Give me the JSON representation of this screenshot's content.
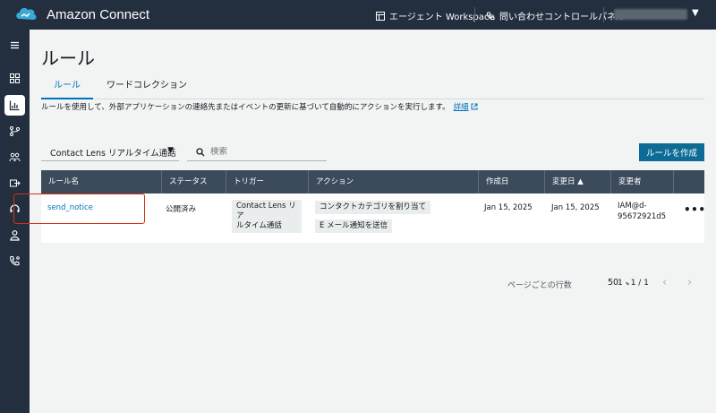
{
  "header": {
    "brand": "Amazon Connect",
    "agent_workspace": "エージェント Workspace",
    "ccp": "問い合わせコントロールパネル"
  },
  "nav": {
    "icons": [
      "menu-icon",
      "dashboard-icon",
      "analytics-icon",
      "routing-icon",
      "users-icon",
      "channels-icon",
      "headset-icon",
      "profile-icon",
      "phone-icon"
    ]
  },
  "page": {
    "title": "ルール",
    "tabs": [
      "ルール",
      "ワードコレクション"
    ],
    "description": "ルールを使用して、外部アプリケーションの連絡先またはイベントの更新に基づいて自動的にアクションを実行します。",
    "details_link": "詳細"
  },
  "filters": {
    "type_select": "Contact Lens リアルタイム通話",
    "search_placeholder": "検索",
    "create_button": "ルールを作成"
  },
  "table": {
    "headers": [
      "ルール名",
      "ステータス",
      "トリガー",
      "アクション",
      "作成日",
      "変更日 ▲",
      "変更者"
    ],
    "row": {
      "name": "send_notice",
      "status": "公開済み",
      "trigger_line1": "Contact Lens リア",
      "trigger_line2": "ルタイム通話",
      "action1": "コンタクトカテゴリを割り当て",
      "action2": "E メール通知を送信",
      "created": "Jan 15, 2025",
      "modified": "Jan 15, 2025",
      "modified_by_line1": "IAM@d-",
      "modified_by_line2": "95672921d5",
      "more": "•••"
    }
  },
  "pagination": {
    "rows_label": "ページごとの行数",
    "page_size": "50",
    "range": "1 - 1 / 1"
  },
  "colors": {
    "topbar": "#232f3e",
    "accent": "#0073bb",
    "primary_button": "#0d6b96",
    "table_header": "#3b4b5c",
    "highlight": "#d13212"
  }
}
